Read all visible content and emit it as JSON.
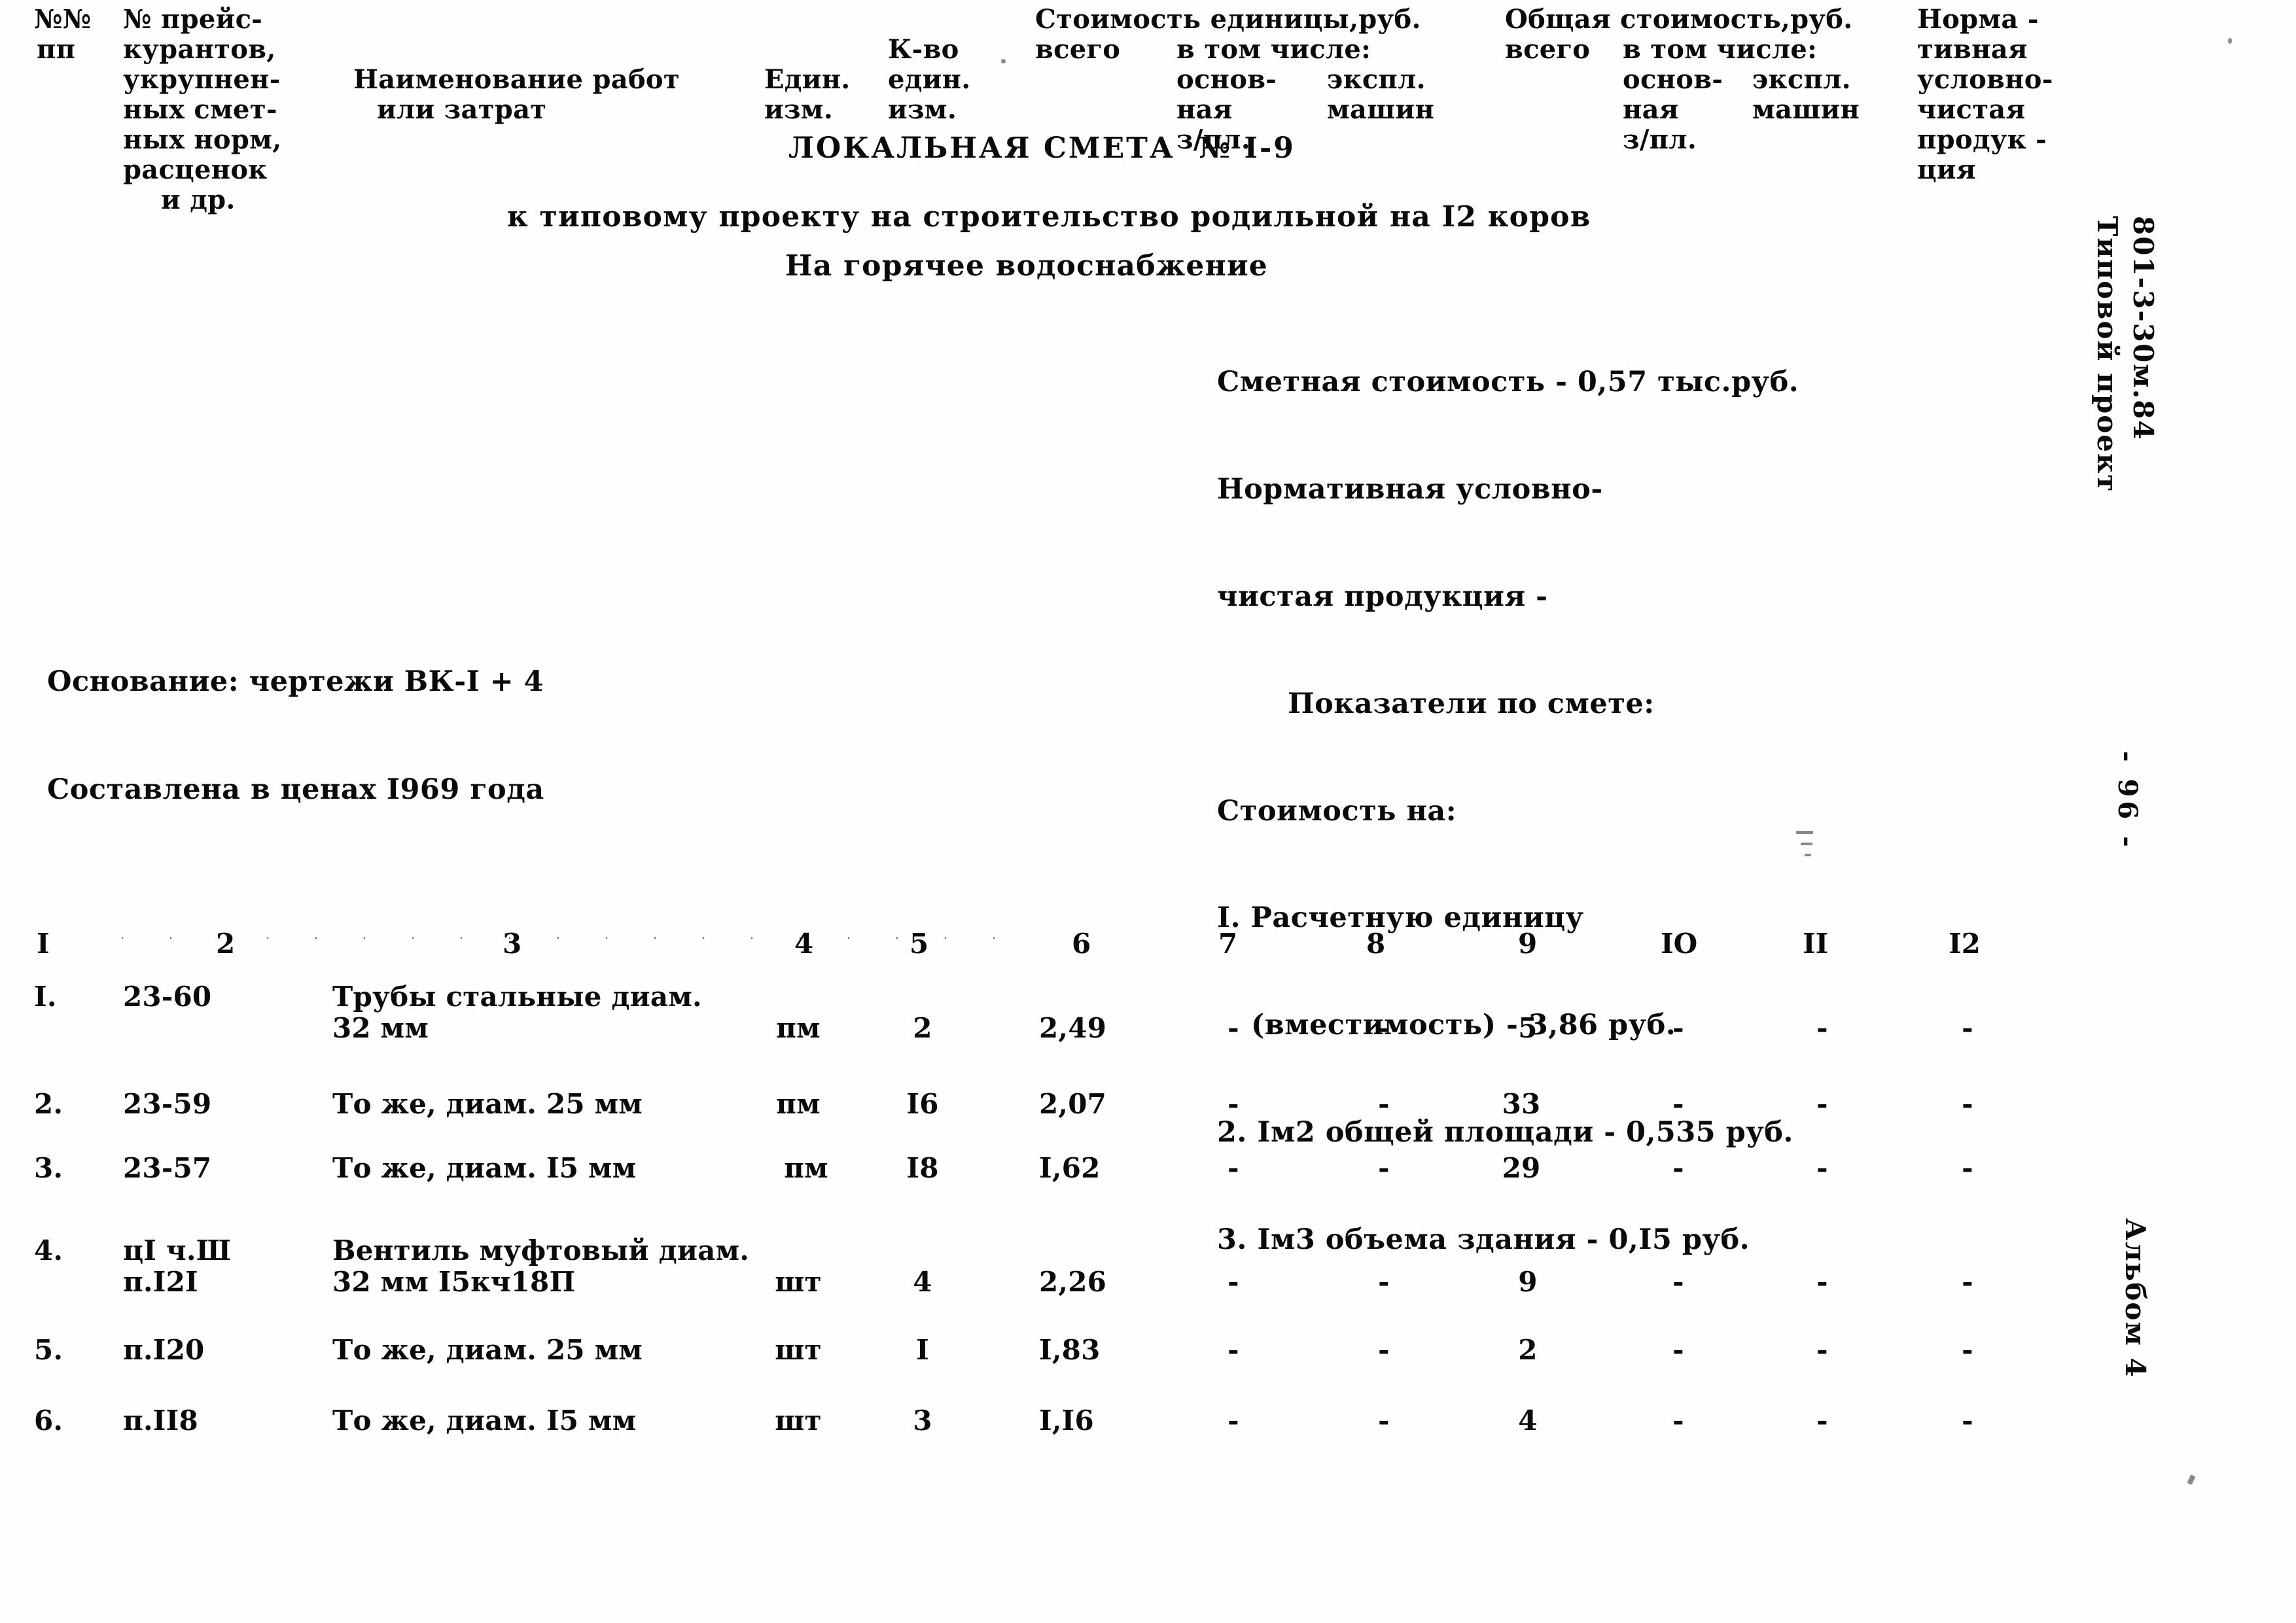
{
  "document": {
    "title": "ЛОКАЛЬНАЯ СМЕТА  № I-9",
    "subtitle": "к типовому проекту на строительство родильной на I2 коров",
    "subtitle2": "На горячее водоснабжение"
  },
  "summary": {
    "estimated_cost": "Сметная стоимость - 0,57 тыс.руб.",
    "normative_line1": "Нормативная условно-",
    "normative_line2": "чистая продукция -",
    "indicators_heading": "Показатели по смете:",
    "cost_per_heading": "Стоимость на:",
    "item1_line1": "I. Расчетную единицу",
    "item1_line2": "(вместимость) - 3,86 руб.",
    "item2": "2. Iм2 общей площади - 0,535 руб.",
    "item3": "3. Iм3 объема здания - 0,I5 руб."
  },
  "basis": {
    "line1": "Основание: чертежи ВК-I + 4",
    "line2": "Составлена в ценах I969 года"
  },
  "table": {
    "headers": {
      "col1_line1": "№№",
      "col1_line2": "пп",
      "col2_line1": "№ прейс-",
      "col2_line2": "курантов,",
      "col2_line3": "укрупнен-",
      "col2_line4": "ных смет-",
      "col2_line5": "ных норм,",
      "col2_line6": "расценок",
      "col2_line7": "и др.",
      "col3_line1": "Наименование работ",
      "col3_line2": "или затрат",
      "col4_line1": "Един.",
      "col4_line2": "изм.",
      "col5_line1": "К-во",
      "col5_line2": "един.",
      "col5_line3": "изм.",
      "group_unit_cost": "Стоимость единицы,руб.",
      "unit_total": "всего",
      "unit_including": "в том числе:",
      "unit_basic_line1": "основ-",
      "unit_basic_line2": "ная",
      "unit_basic_line3": "з/пл.",
      "unit_machines_line1": "экспл.",
      "unit_machines_line2": "машин",
      "group_total_cost": "Общая стоимость,руб.",
      "total_all": "всего",
      "total_including": "в том числе:",
      "total_basic_line1": "основ-",
      "total_basic_line2": "ная",
      "total_basic_line3": "з/пл.",
      "total_machines_line1": "экспл.",
      "total_machines_line2": "машин",
      "col12_line1": "Норма -",
      "col12_line2": "тивная",
      "col12_line3": "условно-",
      "col12_line4": "чистая",
      "col12_line5": "продук -",
      "col12_line6": "ция"
    },
    "column_numbers": [
      "I",
      "2",
      "3",
      "4",
      "5",
      "6",
      "7",
      "8",
      "9",
      "IO",
      "II",
      "I2"
    ],
    "rows": [
      {
        "num": "I.",
        "code": "23-60",
        "name_line1": "Трубы стальные диам.",
        "name_line2": "32 мм",
        "unit": "пм",
        "qty": "2",
        "unit_cost_total": "2,49",
        "unit_cost_basic": "-",
        "unit_cost_machines": "-",
        "total_all": "5",
        "total_basic": "-",
        "total_machines": "-",
        "normative": "-"
      },
      {
        "num": "2.",
        "code": "23-59",
        "name_line1": "То же, диам. 25 мм",
        "name_line2": "",
        "unit": "пм",
        "qty": "I6",
        "unit_cost_total": "2,07",
        "unit_cost_basic": "-",
        "unit_cost_machines": "-",
        "total_all": "33",
        "total_basic": "-",
        "total_machines": "-",
        "normative": "-"
      },
      {
        "num": "3.",
        "code": "23-57",
        "name_line1": "То же, диам. I5 мм",
        "name_line2": "",
        "unit": "пм",
        "qty": "I8",
        "unit_cost_total": "I,62",
        "unit_cost_basic": "-",
        "unit_cost_machines": "-",
        "total_all": "29",
        "total_basic": "-",
        "total_machines": "-",
        "normative": "-"
      },
      {
        "num": "4.",
        "code": "цI ч.Ш",
        "code_line2": "п.I2I",
        "name_line1": "Вентиль муфтовый диам.",
        "name_line2": "32 мм I5кч18П",
        "unit": "шт",
        "qty": "4",
        "unit_cost_total": "2,26",
        "unit_cost_basic": "-",
        "unit_cost_machines": "-",
        "total_all": "9",
        "total_basic": "-",
        "total_machines": "-",
        "normative": "-"
      },
      {
        "num": "5.",
        "code": "п.I20",
        "name_line1": "То же, диам. 25 мм",
        "name_line2": "",
        "unit": "шт",
        "qty": "I",
        "unit_cost_total": "I,83",
        "unit_cost_basic": "-",
        "unit_cost_machines": "-",
        "total_all": "2",
        "total_basic": "-",
        "total_machines": "-",
        "normative": "-"
      },
      {
        "num": "6.",
        "code": "п.II8",
        "name_line1": "То же, диам. I5 мм",
        "name_line2": "",
        "unit": "шт",
        "qty": "3",
        "unit_cost_total": "I,I6",
        "unit_cost_basic": "-",
        "unit_cost_machines": "-",
        "total_all": "4",
        "total_basic": "-",
        "total_machines": "-",
        "normative": "-"
      }
    ]
  },
  "margins": {
    "project_line1": "Типовой проект",
    "project_line2": "801-3-30м.84",
    "page_number": "- 96 -",
    "album": "Альбом 4"
  }
}
